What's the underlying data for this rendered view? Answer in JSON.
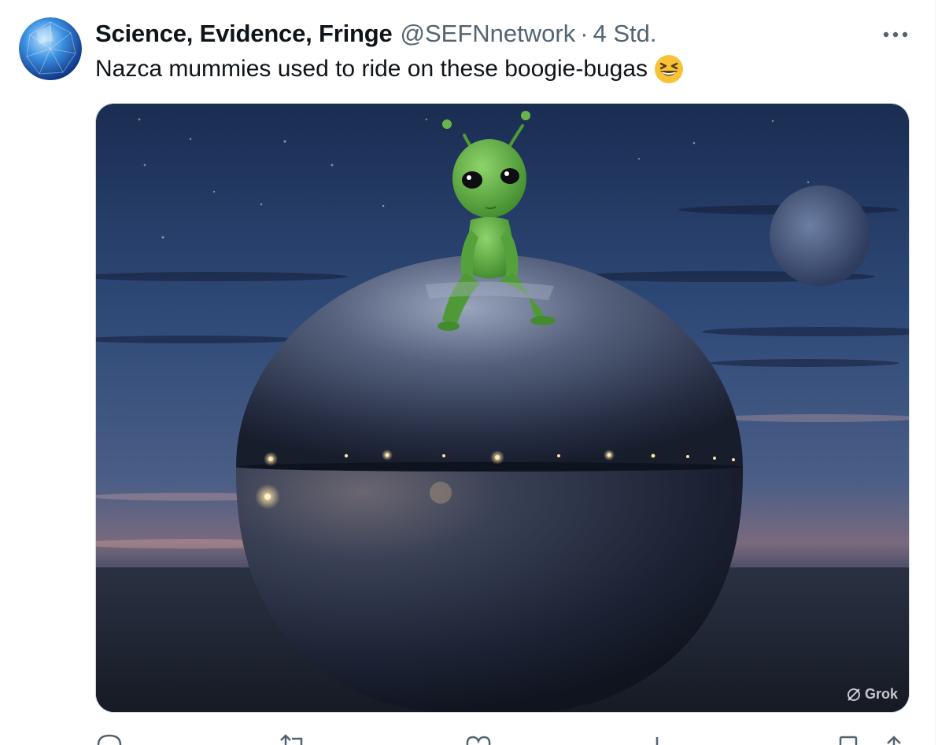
{
  "tweet": {
    "author_name": "Science, Evidence, Fringe",
    "author_handle": "@SEFNnetwork",
    "separator": "·",
    "timestamp": "4 Std.",
    "text": "Nazca mummies used to ride on these boogie-bugas",
    "emoji": "grinning-squinting-face",
    "media": {
      "watermark": "Grok"
    }
  },
  "icons": {
    "more": "more-horizontal-icon",
    "reply": "reply-icon",
    "retweet": "retweet-icon",
    "like": "like-icon",
    "views": "views-icon",
    "bookmark": "bookmark-icon",
    "share": "share-icon"
  },
  "colors": {
    "text_primary": "#0f1419",
    "text_secondary": "#536471",
    "border": "#cfd9de"
  }
}
